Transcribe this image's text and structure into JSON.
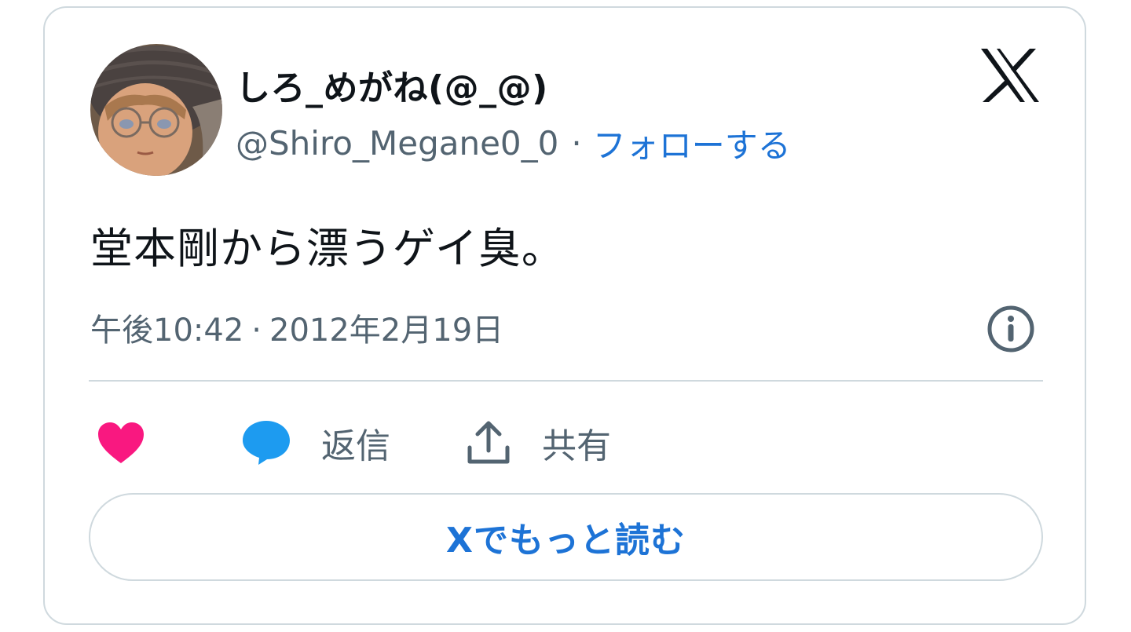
{
  "author": {
    "display_name": "しろ_めがね(@_@)",
    "handle": "@Shiro_Megane0_0",
    "separator": "·",
    "follow_label": "フォローする"
  },
  "tweet": {
    "text": "堂本剛から漂うゲイ臭。",
    "time": "午後10:42",
    "separator": "·",
    "date": "2012年2月19日"
  },
  "actions": {
    "like_label": "",
    "reply_label": "返信",
    "share_label": "共有"
  },
  "read_more_label": "Xでもっと読む",
  "icons": {
    "brand": "x-logo-icon",
    "info": "info-icon",
    "like": "heart-icon",
    "reply": "speech-bubble-icon",
    "share": "share-upload-icon"
  },
  "colors": {
    "link": "#1d73d6",
    "text_primary": "#0f1419",
    "text_secondary": "#536471",
    "border": "#cfd9de",
    "heart": "#f91880",
    "reply_bubble": "#1d9bf0"
  }
}
